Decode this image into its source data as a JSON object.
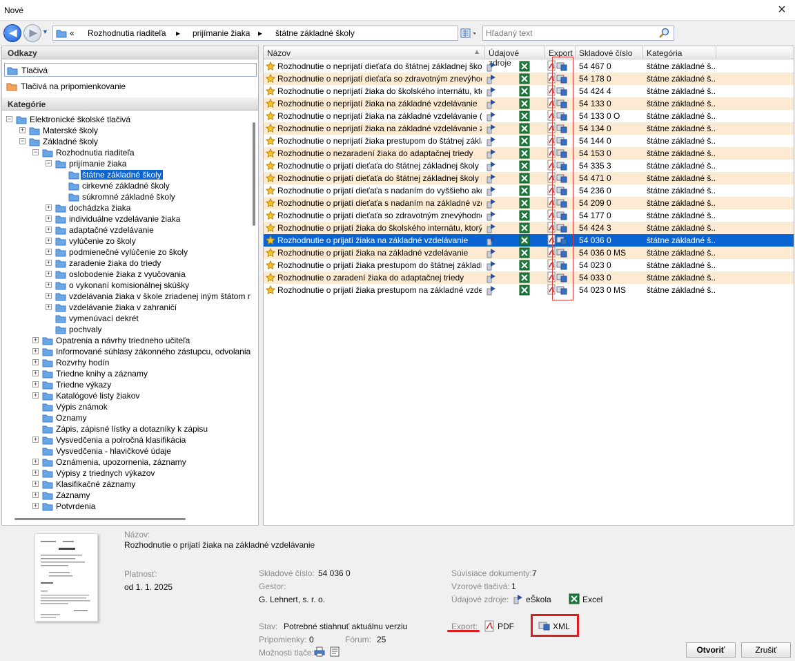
{
  "window": {
    "title": "Nové",
    "close": "×"
  },
  "nav": {
    "back": "◀",
    "forward": "▶",
    "breadcrumb": [
      "«",
      "Rozhodnutia riaditeľa",
      "▸",
      "prijímanie žiaka",
      "▸",
      "štátne základné školy"
    ],
    "search_placeholder": "Hľadaný text"
  },
  "left": {
    "links_header": "Odkazy",
    "links": [
      "Tlačivá",
      "Tlačivá na pripomienkovanie"
    ],
    "categories_header": "Kategórie",
    "tree": [
      {
        "label": "Elektronické školské tlačivá",
        "level": 0,
        "pm": "−"
      },
      {
        "label": "Materské školy",
        "level": 1,
        "pm": "+"
      },
      {
        "label": "Základné školy",
        "level": 1,
        "pm": "−"
      },
      {
        "label": "Rozhodnutia riaditeľa",
        "level": 2,
        "pm": "−"
      },
      {
        "label": "prijímanie žiaka",
        "level": 3,
        "pm": "−"
      },
      {
        "label": "štátne základné školy",
        "level": 4,
        "pm": "",
        "sel": true
      },
      {
        "label": "cirkevné základné školy",
        "level": 4,
        "pm": ""
      },
      {
        "label": "súkromné základné školy",
        "level": 4,
        "pm": ""
      },
      {
        "label": "dochádzka žiaka",
        "level": 3,
        "pm": "+"
      },
      {
        "label": "individuálne vzdelávanie žiaka",
        "level": 3,
        "pm": "+"
      },
      {
        "label": "adaptačné vzdelávanie",
        "level": 3,
        "pm": "+"
      },
      {
        "label": "vylúčenie zo školy",
        "level": 3,
        "pm": "+"
      },
      {
        "label": "podmienečné vylúčenie zo školy",
        "level": 3,
        "pm": "+"
      },
      {
        "label": "zaradenie žiaka do triedy",
        "level": 3,
        "pm": "+"
      },
      {
        "label": "oslobodenie žiaka z vyučovania",
        "level": 3,
        "pm": "+"
      },
      {
        "label": "o vykonaní komisionálnej skúšky",
        "level": 3,
        "pm": "+"
      },
      {
        "label": "vzdelávania žiaka v škole zriadenej iným štátom n",
        "level": 3,
        "pm": "+"
      },
      {
        "label": "vzdelávanie žiaka v zahraničí",
        "level": 3,
        "pm": "+"
      },
      {
        "label": "vymenúvací dekrét",
        "level": 3,
        "pm": ""
      },
      {
        "label": "pochvaly",
        "level": 3,
        "pm": ""
      },
      {
        "label": "Opatrenia a návrhy  triedneho učiteľa",
        "level": 2,
        "pm": "+"
      },
      {
        "label": "Informované súhlasy zákonného zástupcu, odvolania",
        "level": 2,
        "pm": "+"
      },
      {
        "label": "Rozvrhy hodín",
        "level": 2,
        "pm": "+"
      },
      {
        "label": "Triedne knihy a záznamy",
        "level": 2,
        "pm": "+"
      },
      {
        "label": "Triedne výkazy",
        "level": 2,
        "pm": "+"
      },
      {
        "label": "Katalógové listy žiakov",
        "level": 2,
        "pm": "+"
      },
      {
        "label": "Výpis známok",
        "level": 2,
        "pm": ""
      },
      {
        "label": "Oznamy",
        "level": 2,
        "pm": ""
      },
      {
        "label": "Zápis, zápisné lístky a dotazníky k zápisu",
        "level": 2,
        "pm": ""
      },
      {
        "label": "Vysvedčenia a polročná klasifikácia",
        "level": 2,
        "pm": "+"
      },
      {
        "label": "Vysvedčenia - hlavičkové údaje",
        "level": 2,
        "pm": ""
      },
      {
        "label": "Oznámenia, upozornenia, záznamy",
        "level": 2,
        "pm": "+"
      },
      {
        "label": "Výpisy z triednych výkazov",
        "level": 2,
        "pm": "+"
      },
      {
        "label": "Klasifikačné záznamy",
        "level": 2,
        "pm": "+"
      },
      {
        "label": "Záznamy",
        "level": 2,
        "pm": "+"
      },
      {
        "label": "Potvrdenia",
        "level": 2,
        "pm": "+"
      }
    ]
  },
  "grid": {
    "columns": [
      "Názov",
      "Údajové zdroje",
      "Export",
      "Skladové číslo",
      "Kategória"
    ],
    "rows": [
      {
        "name": "Rozhodnutie o neprijatí dieťaťa do štátnej základnej školy...",
        "code": "54  467 0",
        "cat": "štátne základné š..."
      },
      {
        "name": "Rozhodnutie o neprijatí dieťaťa so zdravotným znevýhodn...",
        "code": "54  178 0",
        "cat": "štátne základné š..."
      },
      {
        "name": "Rozhodnutie o neprijatí žiaka do školského internátu, ktor...",
        "code": "54  424 4",
        "cat": "štátne základné š..."
      },
      {
        "name": "Rozhodnutie o neprijatí žiaka na základné vzdelávanie",
        "code": "54  133 0",
        "cat": "štátne základné š..."
      },
      {
        "name": "Rozhodnutie o neprijatí žiaka na základné vzdelávanie (O...",
        "code": "54  133 0 O",
        "cat": "štátne základné š..."
      },
      {
        "name": "Rozhodnutie o neprijatí žiaka na základné vzdelávanie z k...",
        "code": "54  134 0",
        "cat": "štátne základné š..."
      },
      {
        "name": "Rozhodnutie o neprijatí žiaka prestupom do štátnej základ...",
        "code": "54  144 0",
        "cat": "štátne základné š..."
      },
      {
        "name": "Rozhodnutie o nezaradení žiaka do adaptačnej triedy",
        "code": "54  153 0",
        "cat": "štátne základné š..."
      },
      {
        "name": "Rozhodnutie o prijatí dieťaťa do štátnej základnej školy (a...",
        "code": "54  335 3",
        "cat": "štátne základné š..."
      },
      {
        "name": "Rozhodnutie o prijatí dieťaťa do štátnej základnej školy pr...",
        "code": "54  471 0",
        "cat": "štátne základné š..."
      },
      {
        "name": "Rozhodnutie o prijatí dieťaťa s nadaním do vyššieho ako p...",
        "code": "54  236 0",
        "cat": "štátne základné š..."
      },
      {
        "name": "Rozhodnutie o prijatí dieťaťa s nadaním na základné vzdel...",
        "code": "54  209 0",
        "cat": "štátne základné š..."
      },
      {
        "name": "Rozhodnutie o prijatí dieťaťa so zdravotným znevýhodnení...",
        "code": "54  177 0",
        "cat": "štátne základné š..."
      },
      {
        "name": "Rozhodnutie o prijatí žiaka do školského internátu, ktorý je...",
        "code": "54  424 3",
        "cat": "štátne základné š..."
      },
      {
        "name": "Rozhodnutie o prijatí žiaka na základné vzdelávanie",
        "code": "54  036 0",
        "cat": "štátne základné š...",
        "sel": true
      },
      {
        "name": "Rozhodnutie o prijatí žiaka na základné vzdelávanie",
        "code": "54  036 0 MS",
        "cat": "štátne základné š..."
      },
      {
        "name": "Rozhodnutie o prijatí žiaka prestupom do štátnej základne...",
        "code": "54  023 0",
        "cat": "štátne základné š..."
      },
      {
        "name": "Rozhodnutie o zaradení žiaka do adaptačnej triedy",
        "code": "54  033 0",
        "cat": "štátne základné š..."
      },
      {
        "name": "Rozhodnutie o prijatí žiaka prestupom na základné vzdelá...",
        "code": "54  023 0 MS",
        "cat": "štátne základné š..."
      }
    ]
  },
  "details": {
    "name_label": "Názov:",
    "name": "Rozhodnutie o prijatí žiaka na základné vzdelávanie",
    "validity_label": "Platnosť:",
    "validity": "od 1. 1. 2025",
    "stock_label": "Skladové číslo:",
    "stock": "54  036 0",
    "gestor_label": "Gestor:",
    "gestor": "G. Lehnert, s. r. o.",
    "state_label": "Stav:",
    "state": "Potrebné stiahnuť aktuálnu verziu",
    "comments_label": "Pripomienky:",
    "comments": "0",
    "forum_label": "Fórum:",
    "forum": "25",
    "print_label": "Možnosti tlače:",
    "related_label": "Súvisiace dokumenty:",
    "related": "7",
    "samples_label": "Vzorové tlačivá:",
    "samples": "1",
    "sources_label": "Údajové zdroje:",
    "source1": "eŠkola",
    "source2": "Excel",
    "export_label": "Export:",
    "pdf": "PDF",
    "xml": "XML"
  },
  "buttons": {
    "open": "Otvoriť",
    "cancel": "Zrušiť"
  },
  "colors": {
    "selection": "#0a64d2",
    "row_alt": "#fcebd2",
    "highlight_red": "#e01c1c"
  }
}
